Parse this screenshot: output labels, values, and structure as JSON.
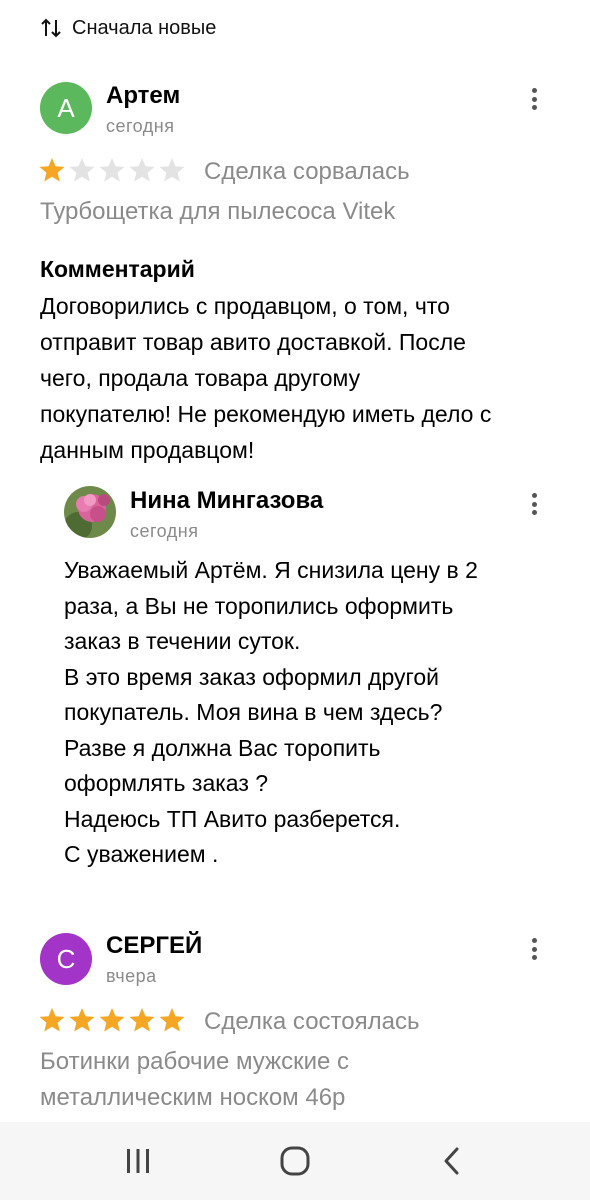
{
  "sort": {
    "label": "Сначала новые",
    "icon": "sort-arrows-icon"
  },
  "reviews": [
    {
      "avatar_letter": "А",
      "avatar_color": "#5cb85c",
      "author": "Артем",
      "date": "сегодня",
      "rating": 1,
      "deal_status": "Сделка сорвалась",
      "item": "Турбощетка для пылесоса Vitek",
      "comment_heading": "Комментарий",
      "comment_lines": [
        "Договорились с продавцом, о том, что",
        "отправит товар авито доставкой. После",
        "чего, продала товара другому",
        "покупателю! Не рекомендую иметь дело с",
        "данным продавцом!"
      ],
      "reply": {
        "author": "Нина Мингазова",
        "date": "сегодня",
        "lines": [
          "Уважаемый Артём.  Я снизила цену в 2",
          "раза, а Вы не торопились оформить",
          "заказ в течении суток.",
          "В это время заказ оформил другой",
          "покупатель. Моя вина в чем здесь?",
          "Разве я должна Вас торопить",
          "оформлять заказ ?",
          "Надеюсь ТП Авито разберется.",
          "С уважением ."
        ]
      }
    },
    {
      "avatar_letter": "С",
      "avatar_color": "#a234c8",
      "author": "СЕРГЕЙ",
      "date": "вчера",
      "rating": 5,
      "deal_status": "Сделка состоялась",
      "item_lines": [
        "Ботинки рабочие мужские с",
        "металлическим носком 46р"
      ]
    }
  ],
  "colors": {
    "star_filled": "#f5a623",
    "star_empty": "#e3e3e3",
    "muted_text": "#8a8a8a"
  },
  "navbar": {
    "icons": [
      "recent-apps-icon",
      "home-icon",
      "back-icon"
    ]
  }
}
